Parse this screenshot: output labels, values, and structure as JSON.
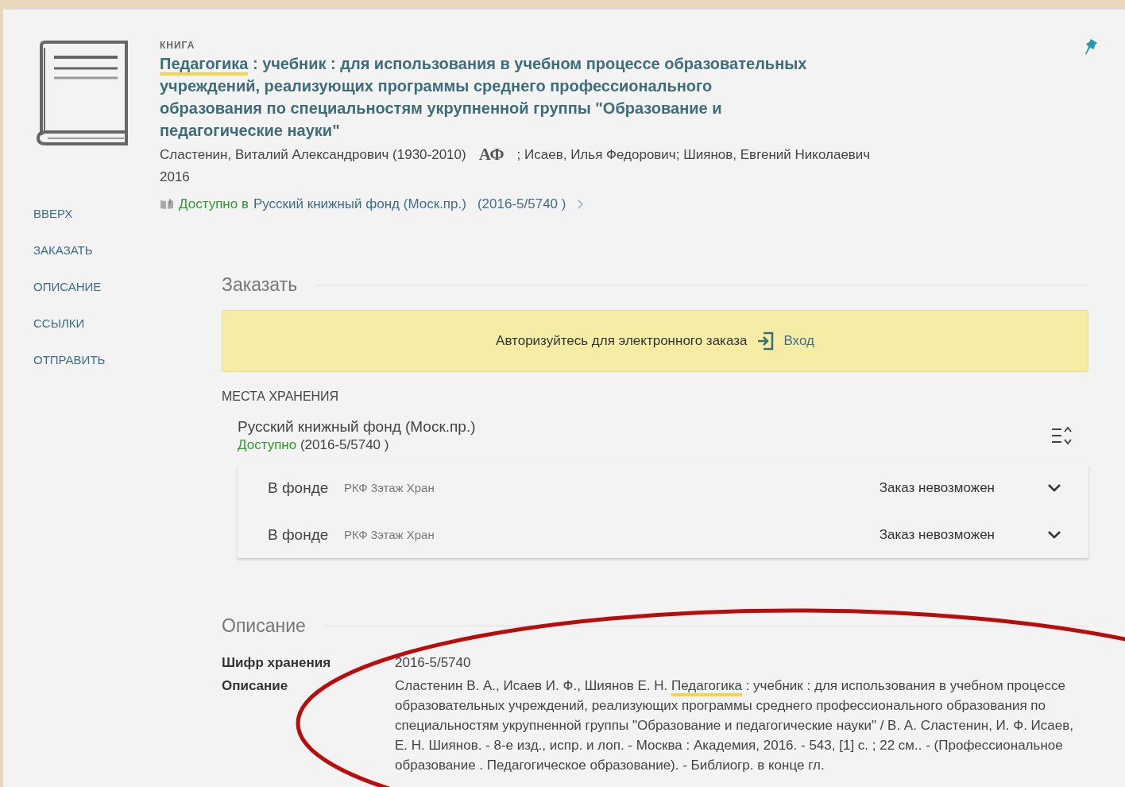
{
  "record": {
    "type_label": "КНИГА",
    "title": {
      "highlight": "Педагогика",
      "rest": " : учебник : для использования в учебном процессе образовательных учреждений, реализующих программы среднего профессионального образования по специальностям укрупненной группы \"Образование и педагогические науки\""
    },
    "author_main": "Сластенин, Виталий Александрович (1930-2010)",
    "authority_badge": "АФ",
    "authors_other": "; Исаев, Илья Федорович; Шиянов, Евгений Николаевич",
    "year": "2016",
    "availability": {
      "status": "Доступно в",
      "location": "Русский книжный фонд (Моск.пр.)",
      "call_number": "(2016-5/5740 )"
    }
  },
  "nav": [
    {
      "label": "ВВЕРХ"
    },
    {
      "label": "ЗАКАЗАТЬ"
    },
    {
      "label": "ОПИСАНИЕ"
    },
    {
      "label": "ССЫЛКИ"
    },
    {
      "label": "ОТПРАВИТЬ"
    }
  ],
  "order": {
    "heading": "Заказать",
    "notice": "Авторизуйтесь для электронного заказа",
    "login": "Вход"
  },
  "holdings": {
    "heading": "МЕСТА ХРАНЕНИЯ",
    "location": "Русский книжный фонд (Моск.пр.)",
    "status": "Доступно",
    "call_number": "(2016-5/5740 )",
    "items": [
      {
        "status": "В фонде",
        "shelf": "РКФ 3этаж Хран",
        "order_status": "Заказ невозможен",
        "expanded": false
      },
      {
        "status": "В фонде",
        "shelf": "РКФ 3этаж Хран",
        "order_status": "Заказ невозможен",
        "expanded": false
      }
    ]
  },
  "description": {
    "heading": "Описание",
    "fields": [
      {
        "label": "Шифр хранения",
        "value": {
          "rest": "2016-5/5740"
        }
      },
      {
        "label": "Описание",
        "value": {
          "prefix": "Сластенин В. А., Исаев И. Ф., Шиянов Е. Н. ",
          "highlight": "Педагогика",
          "rest": " : учебник : для использования в учебном процессе образовательных учреждений, реализующих программы среднего профессионального образования по специальностям укрупненной группы \"Образование и педагогические науки\" / В. А. Сластенин, И. Ф. Исаев, Е. Н. Шиянов. - 8-е изд., испр. и лоп. - Москва : Академия, 2016. - 543, [1] с. ; 22 см.. - (Профессиональное образование . Педагогическое образование). - Библиогр. в конце гл."
        }
      }
    ]
  }
}
